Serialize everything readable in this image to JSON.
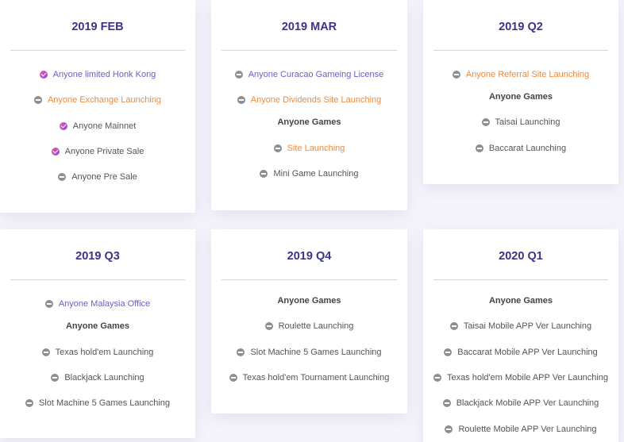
{
  "cards": [
    {
      "title": "2019 FEB",
      "items": [
        {
          "text": "Anyone limited Honk Kong",
          "icon": "check-icon",
          "style": "purple"
        },
        {
          "text": "Anyone Exchange Launching",
          "icon": "minus-icon",
          "style": "orange"
        },
        {
          "text": "Anyone Mainnet",
          "icon": "check-icon",
          "style": "normal"
        },
        {
          "text": "Anyone Private Sale",
          "icon": "check-icon",
          "style": "normal"
        },
        {
          "text": "Anyone Pre Sale",
          "icon": "minus-icon",
          "style": "normal"
        }
      ]
    },
    {
      "title": "2019 MAR",
      "items": [
        {
          "text": "Anyone Curacao Gameing License",
          "icon": "minus-icon",
          "style": "purple"
        },
        {
          "text": "Anyone Dividends Site Launching",
          "icon": "minus-icon",
          "style": "orange"
        },
        {
          "text": "Anyone Games",
          "icon": "",
          "style": "header"
        },
        {
          "text": "Site Launching",
          "icon": "minus-icon",
          "style": "orange"
        },
        {
          "text": "Mini Game Launching",
          "icon": "minus-icon",
          "style": "normal"
        }
      ]
    },
    {
      "title": "2019 Q2",
      "items": [
        {
          "text": "Anyone Referral Site Launching",
          "icon": "minus-icon",
          "style": "orange"
        },
        {
          "text": "Anyone Games",
          "icon": "",
          "style": "header"
        },
        {
          "text": "Taisai Launching",
          "icon": "minus-icon",
          "style": "normal"
        },
        {
          "text": "Baccarat Launching",
          "icon": "minus-icon",
          "style": "normal"
        }
      ]
    },
    {
      "title": "2019 Q3",
      "items": [
        {
          "text": "Anyone Malaysia Office",
          "icon": "minus-icon",
          "style": "purple"
        },
        {
          "text": "Anyone Games",
          "icon": "",
          "style": "header"
        },
        {
          "text": "Texas hold'em Launching",
          "icon": "minus-icon",
          "style": "normal"
        },
        {
          "text": "Blackjack Launching",
          "icon": "minus-icon",
          "style": "normal"
        },
        {
          "text": "Slot Machine 5 Games Launching",
          "icon": "minus-icon",
          "style": "normal"
        }
      ]
    },
    {
      "title": "2019 Q4",
      "items": [
        {
          "text": "Anyone Games",
          "icon": "",
          "style": "header"
        },
        {
          "text": "Roulette Launching",
          "icon": "minus-icon",
          "style": "normal"
        },
        {
          "text": "Slot Machine 5 Games Launching",
          "icon": "minus-icon",
          "style": "normal"
        },
        {
          "text": "Texas hold'em Tournament Launching",
          "icon": "minus-icon",
          "style": "normal"
        }
      ]
    },
    {
      "title": "2020 Q1",
      "items": [
        {
          "text": "Anyone Games",
          "icon": "",
          "style": "header"
        },
        {
          "text": "Taisai Mobile APP Ver Launching",
          "icon": "minus-icon",
          "style": "normal"
        },
        {
          "text": "Baccarat Mobile APP Ver Launching",
          "icon": "minus-icon",
          "style": "normal"
        },
        {
          "text": "Texas hold'em Mobile APP Ver Launching",
          "icon": "minus-icon",
          "style": "normal"
        },
        {
          "text": "Blackjack Mobile APP Ver Launching",
          "icon": "minus-icon",
          "style": "normal"
        },
        {
          "text": "Roulette Mobile APP Ver Launching",
          "icon": "minus-icon",
          "style": "normal"
        }
      ]
    }
  ]
}
